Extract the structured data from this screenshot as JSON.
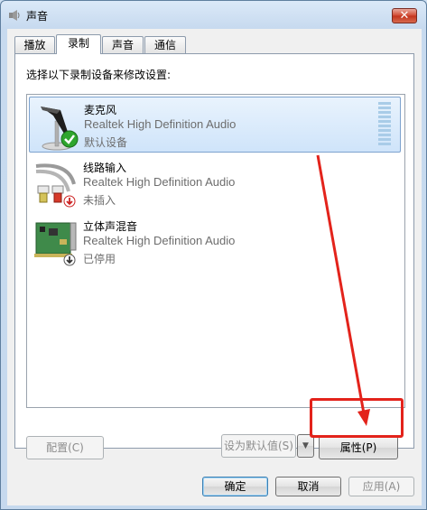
{
  "window": {
    "title": "声音",
    "close_symbol": "✕",
    "icon": "speaker-icon"
  },
  "tabs": [
    {
      "label": "播放",
      "active": false
    },
    {
      "label": "录制",
      "active": true
    },
    {
      "label": "声音",
      "active": false
    },
    {
      "label": "通信",
      "active": false
    }
  ],
  "panel": {
    "instruction": "选择以下录制设备来修改设置:"
  },
  "devices": [
    {
      "name": "麦克风",
      "driver": "Realtek High Definition Audio",
      "status": "默认设备",
      "icon": "microphone-icon",
      "badge": "green-check-icon",
      "selected": true
    },
    {
      "name": "线路输入",
      "driver": "Realtek High Definition Audio",
      "status": "未插入",
      "icon": "rca-cable-icon",
      "badge": "red-down-arrow-icon",
      "selected": false
    },
    {
      "name": "立体声混音",
      "driver": "Realtek High Definition Audio",
      "status": "已停用",
      "icon": "sound-card-icon",
      "badge": "gray-down-arrow-icon",
      "selected": false
    }
  ],
  "buttons": {
    "configure": "配置(C)",
    "set_default": "设为默认值(S)",
    "dropdown_symbol": "▼",
    "properties": "属性(P)",
    "ok": "确定",
    "cancel": "取消",
    "apply": "应用(A)"
  },
  "colors": {
    "annotation_red": "#e3231b",
    "selection_blue": "#cfe4fa"
  }
}
